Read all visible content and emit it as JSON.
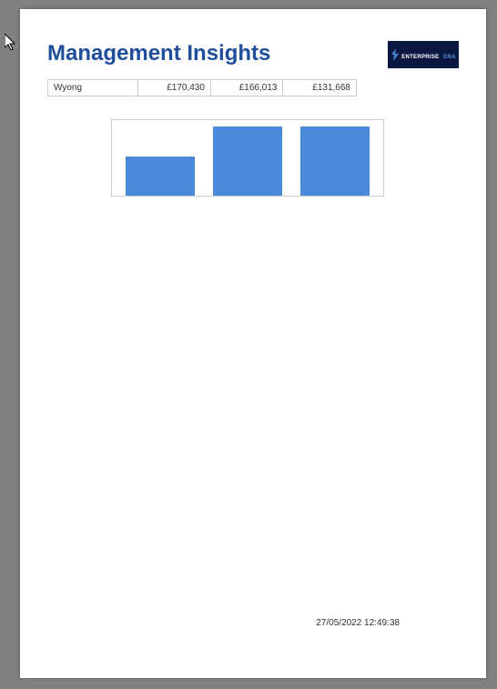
{
  "header": {
    "title": "Management Insights",
    "logo_text_main": "ENTERPRISE",
    "logo_text_accent": "DNA"
  },
  "table": {
    "row_label": "Wyong",
    "values": [
      "£170,430",
      "£166,013",
      "£131,668"
    ]
  },
  "chart_data": {
    "type": "bar",
    "categories": [
      "",
      "",
      ""
    ],
    "values": [
      44,
      78,
      78
    ],
    "title": "",
    "xlabel": "",
    "ylabel": "",
    "ylim": [
      0,
      85
    ]
  },
  "footer": {
    "timestamp": "27/05/2022 12:49:38"
  }
}
